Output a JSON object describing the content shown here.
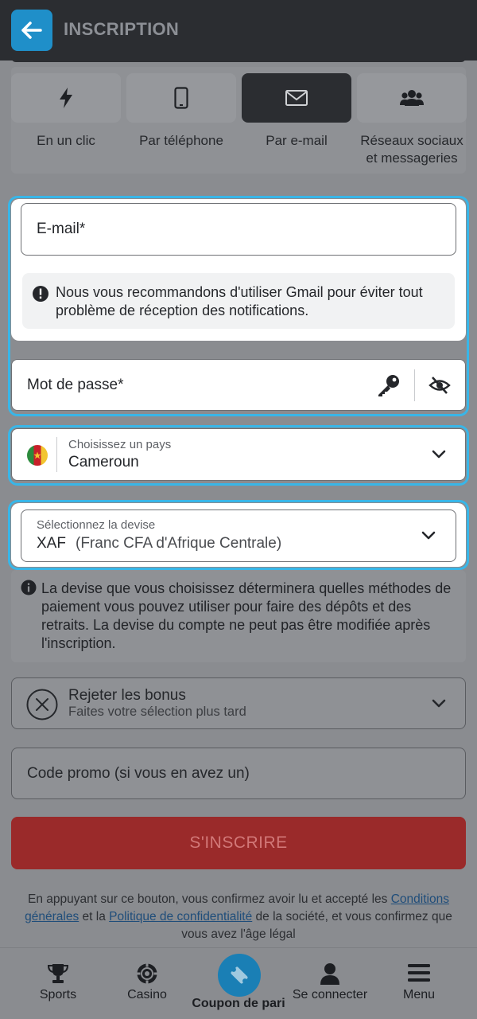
{
  "header": {
    "title": "INSCRIPTION"
  },
  "tabs": [
    {
      "label": "En un clic",
      "icon": "lightning-icon"
    },
    {
      "label": "Par téléphone",
      "icon": "phone-icon"
    },
    {
      "label": "Par e-mail",
      "icon": "envelope-icon",
      "active": true
    },
    {
      "label": "Réseaux sociaux\net messageries",
      "icon": "users-icon"
    }
  ],
  "form": {
    "email_placeholder": "E-mail*",
    "gmail_notice": "Nous vous recommandons d'utiliser Gmail pour éviter tout problème de réception des notifications.",
    "password_placeholder": "Mot de passe*",
    "country_label": "Choisissez un pays",
    "country_value": "Cameroun",
    "currency_label": "Sélectionnez la devise",
    "currency_code": "XAF",
    "currency_name": "(Franc CFA d'Afrique Centrale)",
    "currency_info": "La devise que vous choisissez déterminera quelles méthodes de paiement vous pouvez utiliser pour faire des dépôts et des retraits. La devise du compte ne peut pas être modifiée après l'inscription.",
    "bonus_title": "Rejeter les bonus",
    "bonus_subtitle": "Faites votre sélection plus tard",
    "promo_placeholder": "Code promo (si vous en avez un)",
    "submit_label": "S'INSCRIRE"
  },
  "legal": {
    "text_1": "En appuyant sur ce bouton, vous confirmez avoir lu et accepté les ",
    "link_terms": "Conditions générales",
    "text_2": " et la ",
    "link_privacy": "Politique de confidentialité",
    "text_3": " de la société, et vous confirmez que vous avez l'âge légal"
  },
  "bottom_nav": {
    "sports": "Sports",
    "casino": "Casino",
    "coupon": "Coupon de pari",
    "login": "Se connecter",
    "menu": "Menu"
  },
  "colors": {
    "accent_blue": "#1f8fc9",
    "highlight_border": "#38b6e8",
    "submit_red": "#9a2a2a",
    "header_dark": "#2b2d31"
  }
}
